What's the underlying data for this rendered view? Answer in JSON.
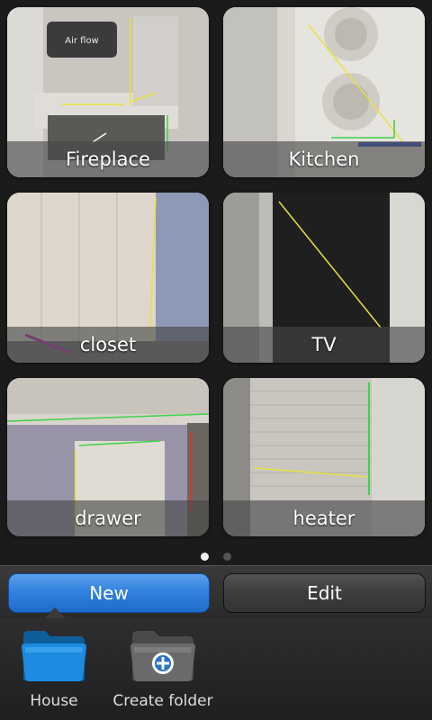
{
  "tiles": [
    {
      "label": "Fireplace"
    },
    {
      "label": "Kitchen"
    },
    {
      "label": "closet"
    },
    {
      "label": "TV"
    },
    {
      "label": "drawer"
    },
    {
      "label": "heater"
    }
  ],
  "photo_annotations": {
    "fireplace_note": "Air flow"
  },
  "pager": {
    "pages": 2,
    "current": 1
  },
  "actions": {
    "new_label": "New",
    "edit_label": "Edit"
  },
  "folders": [
    {
      "label": "House",
      "icon": "folder-icon",
      "selected": true
    },
    {
      "label": "Create folder",
      "icon": "add-folder-icon",
      "selected": false
    }
  ],
  "colors": {
    "accent_blue": "#2f7fdc",
    "measure_yellow": "#e8e040",
    "measure_green": "#3fd24a"
  }
}
